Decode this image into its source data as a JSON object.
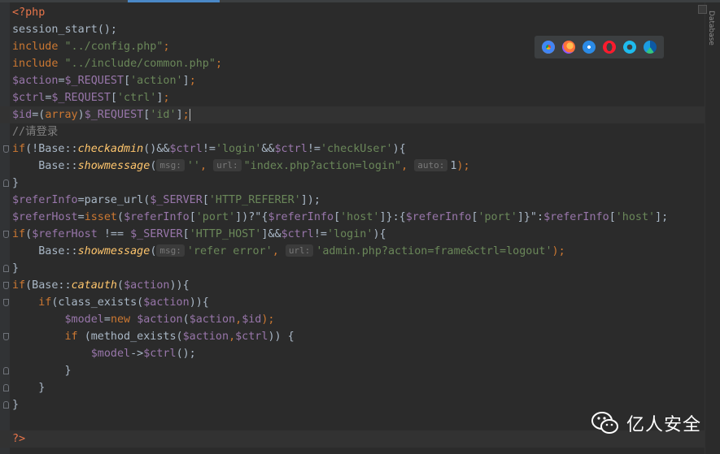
{
  "window": {
    "side_panel_label": "Database"
  },
  "browsers": [
    {
      "name": "chrome-icon"
    },
    {
      "name": "firefox-icon"
    },
    {
      "name": "safari-icon"
    },
    {
      "name": "opera-icon"
    },
    {
      "name": "ie-icon"
    },
    {
      "name": "edge-icon"
    }
  ],
  "colors": {
    "background": "#2b2b2b",
    "keyword": "#cc7832",
    "string": "#6a8759",
    "variable": "#9876aa",
    "function": "#ffc66d",
    "comment": "#808080",
    "default": "#a9b7c6"
  },
  "code": [
    {
      "t": [
        [
          "<?php",
          "php"
        ]
      ]
    },
    {
      "t": [
        [
          "session_start",
          "plain"
        ],
        [
          "();",
          "plain"
        ]
      ]
    },
    {
      "t": [
        [
          "include ",
          "kw"
        ],
        [
          "\"../config.php\"",
          "str"
        ],
        [
          ";",
          "kw"
        ]
      ]
    },
    {
      "t": [
        [
          "include ",
          "kw"
        ],
        [
          "\"../include/common.php\"",
          "str"
        ],
        [
          ";",
          "kw"
        ]
      ]
    },
    {
      "t": [
        [
          "$action",
          "var"
        ],
        [
          "=",
          "plain"
        ],
        [
          "$_REQUEST",
          "var"
        ],
        [
          "[",
          "plain"
        ],
        [
          "'action'",
          "str"
        ],
        [
          "]",
          "plain"
        ],
        [
          ";",
          "kw"
        ]
      ]
    },
    {
      "t": [
        [
          "$ctrl",
          "var"
        ],
        [
          "=",
          "plain"
        ],
        [
          "$_REQUEST",
          "var"
        ],
        [
          "[",
          "plain"
        ],
        [
          "'ctrl'",
          "str"
        ],
        [
          "]",
          "plain"
        ],
        [
          ";",
          "kw"
        ]
      ]
    },
    {
      "t": [
        [
          "$id",
          "var"
        ],
        [
          "=(",
          "plain"
        ],
        [
          "array",
          "kw"
        ],
        [
          ")",
          "plain"
        ],
        [
          "$_REQUEST",
          "var"
        ],
        [
          "[",
          "plain"
        ],
        [
          "'id'",
          "str"
        ],
        [
          "]",
          "plain"
        ],
        [
          ";",
          "kw"
        ]
      ],
      "current": true
    },
    {
      "t": [
        [
          "//请登录",
          "cmt"
        ]
      ]
    },
    {
      "t": [
        [
          "if",
          "kw"
        ],
        [
          "(!Base::",
          "plain"
        ],
        [
          "checkadmin",
          "fn"
        ],
        [
          "()&&",
          "plain"
        ],
        [
          "$ctrl",
          "var"
        ],
        [
          "!=",
          "plain"
        ],
        [
          "'login'",
          "str"
        ],
        [
          "&&",
          "plain"
        ],
        [
          "$ctrl",
          "var"
        ],
        [
          "!=",
          "plain"
        ],
        [
          "'checkUser'",
          "str"
        ],
        [
          "){",
          "plain"
        ]
      ]
    },
    {
      "t": [
        [
          "    Base::",
          "plain"
        ],
        [
          "showmessage",
          "fn"
        ],
        [
          "(",
          "plain"
        ],
        [
          "msg:",
          "hint"
        ],
        [
          "''",
          "str"
        ],
        [
          ", ",
          "kw"
        ],
        [
          "url:",
          "hint"
        ],
        [
          "\"index.php?action=login\"",
          "str"
        ],
        [
          ", ",
          "kw"
        ],
        [
          "auto:",
          "hint"
        ],
        [
          "1",
          "plain"
        ],
        [
          ");",
          "kw"
        ]
      ]
    },
    {
      "t": [
        [
          "}",
          "plain"
        ]
      ]
    },
    {
      "t": [
        [
          "$referInfo",
          "var"
        ],
        [
          "=parse_url(",
          "plain"
        ],
        [
          "$_SERVER",
          "var"
        ],
        [
          "[",
          "plain"
        ],
        [
          "'HTTP_REFERER'",
          "str"
        ],
        [
          "]);",
          "plain"
        ]
      ]
    },
    {
      "t": [
        [
          "$referHost",
          "var"
        ],
        [
          "=",
          "plain"
        ],
        [
          "isset",
          "kw"
        ],
        [
          "(",
          "plain"
        ],
        [
          "$referInfo",
          "var"
        ],
        [
          "[",
          "plain"
        ],
        [
          "'port'",
          "str"
        ],
        [
          "])?\"{",
          "plain"
        ],
        [
          "$referInfo",
          "var"
        ],
        [
          "[",
          "plain"
        ],
        [
          "'host'",
          "str"
        ],
        [
          "]}:{",
          "plain"
        ],
        [
          "$referInfo",
          "var"
        ],
        [
          "[",
          "plain"
        ],
        [
          "'port'",
          "str"
        ],
        [
          "]}\":",
          "plain"
        ],
        [
          "$referInfo",
          "var"
        ],
        [
          "[",
          "plain"
        ],
        [
          "'host'",
          "str"
        ],
        [
          "];",
          "plain"
        ]
      ]
    },
    {
      "t": [
        [
          "if",
          "kw"
        ],
        [
          "(",
          "plain"
        ],
        [
          "$referHost",
          "var"
        ],
        [
          " !== ",
          "plain"
        ],
        [
          "$_SERVER",
          "var"
        ],
        [
          "[",
          "plain"
        ],
        [
          "'HTTP_HOST'",
          "str"
        ],
        [
          "]&&",
          "plain"
        ],
        [
          "$ctrl",
          "var"
        ],
        [
          "!=",
          "plain"
        ],
        [
          "'login'",
          "str"
        ],
        [
          "){",
          "plain"
        ]
      ]
    },
    {
      "t": [
        [
          "    Base::",
          "plain"
        ],
        [
          "showmessage",
          "fn"
        ],
        [
          "(",
          "plain"
        ],
        [
          "msg:",
          "hint"
        ],
        [
          "'refer error'",
          "str"
        ],
        [
          ", ",
          "kw"
        ],
        [
          "url:",
          "hint"
        ],
        [
          "'admin.php?action=frame&ctrl=logout'",
          "str"
        ],
        [
          ");",
          "kw"
        ]
      ]
    },
    {
      "t": [
        [
          "}",
          "plain"
        ]
      ]
    },
    {
      "t": [
        [
          "if",
          "kw"
        ],
        [
          "(Base::",
          "plain"
        ],
        [
          "catauth",
          "fn"
        ],
        [
          "(",
          "plain"
        ],
        [
          "$action",
          "var"
        ],
        [
          ")){",
          "plain"
        ]
      ]
    },
    {
      "t": [
        [
          "    ",
          "plain"
        ],
        [
          "if",
          "kw"
        ],
        [
          "(class_exists(",
          "plain"
        ],
        [
          "$action",
          "var"
        ],
        [
          ")){",
          "plain"
        ]
      ]
    },
    {
      "t": [
        [
          "        ",
          "plain"
        ],
        [
          "$model",
          "var"
        ],
        [
          "=",
          "plain"
        ],
        [
          "new ",
          "kw"
        ],
        [
          "$action",
          "var"
        ],
        [
          "(",
          "plain"
        ],
        [
          "$action",
          "var"
        ],
        [
          ",",
          "kw"
        ],
        [
          "$id",
          "var"
        ],
        [
          ");",
          "kw"
        ]
      ]
    },
    {
      "t": [
        [
          "        ",
          "plain"
        ],
        [
          "if ",
          "kw"
        ],
        [
          "(method_exists(",
          "plain"
        ],
        [
          "$action",
          "var"
        ],
        [
          ",",
          "kw"
        ],
        [
          "$ctrl",
          "var"
        ],
        [
          ")) {",
          "plain"
        ]
      ]
    },
    {
      "t": [
        [
          "            ",
          "plain"
        ],
        [
          "$model",
          "var"
        ],
        [
          "->",
          "plain"
        ],
        [
          "$ctrl",
          "var"
        ],
        [
          "();",
          "plain"
        ]
      ]
    },
    {
      "t": [
        [
          "        }",
          "plain"
        ]
      ]
    },
    {
      "t": [
        [
          "    }",
          "plain"
        ]
      ]
    },
    {
      "t": [
        [
          "}",
          "plain"
        ]
      ]
    },
    {
      "t": [
        [
          "",
          "plain"
        ]
      ]
    },
    {
      "t": [
        [
          "?>",
          "php"
        ]
      ],
      "current": true
    }
  ],
  "watermark": {
    "text": "亿人安全"
  }
}
